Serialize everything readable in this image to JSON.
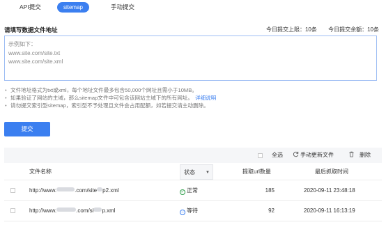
{
  "tabs": [
    {
      "label": "API提交"
    },
    {
      "label": "sitemap"
    },
    {
      "label": "手动提交"
    }
  ],
  "form": {
    "title": "请填写数据文件地址",
    "quota_limit": "今日提交上限：10条",
    "quota_remaining": "今日提交余额：10条",
    "placeholder_lines": [
      "示例如下：",
      "www.site.com/site.txt",
      "www.site.com/site.xml"
    ]
  },
  "notes": {
    "line1": "文件地址格式为txt或xml，每个地址文件最多包含50,000个网址且需小于10MB。",
    "line2": "如果验证了网站的主域，那么sitemap文件中可包含该网站主域下的所有网址。",
    "line2_link": "详细说明",
    "line3": "请勿提交索引型sitemap，索引型不予处理且文件会占用配额，如若提交请主动删除。"
  },
  "submit_label": "提交",
  "toolbar": {
    "select_all": "全选",
    "refresh_icon": "refresh-icon",
    "refresh": "手动更新文件",
    "trash_icon": "trash-icon",
    "delete": "删除"
  },
  "table": {
    "columns": {
      "name": "文件名称",
      "status": "状态",
      "count": "提取url数量",
      "time": "最后抓取时间"
    },
    "rows": [
      {
        "url_prefix": "http://www.",
        "url_mid": ".com/site",
        "url_suffix": "p2.xml",
        "status": "正常",
        "count": "185",
        "time": "2020-09-11 23:48:18"
      },
      {
        "url_prefix": "http://www.",
        "url_mid": ".com/si",
        "url_suffix": "p.xml",
        "status": "等待",
        "count": "92",
        "time": "2020-09-11 16:13:19"
      }
    ]
  },
  "colors": {
    "accent": "#3b7ff0",
    "status_ok": "#2a9d47",
    "toolbar_bg": "#f5f6f8"
  }
}
